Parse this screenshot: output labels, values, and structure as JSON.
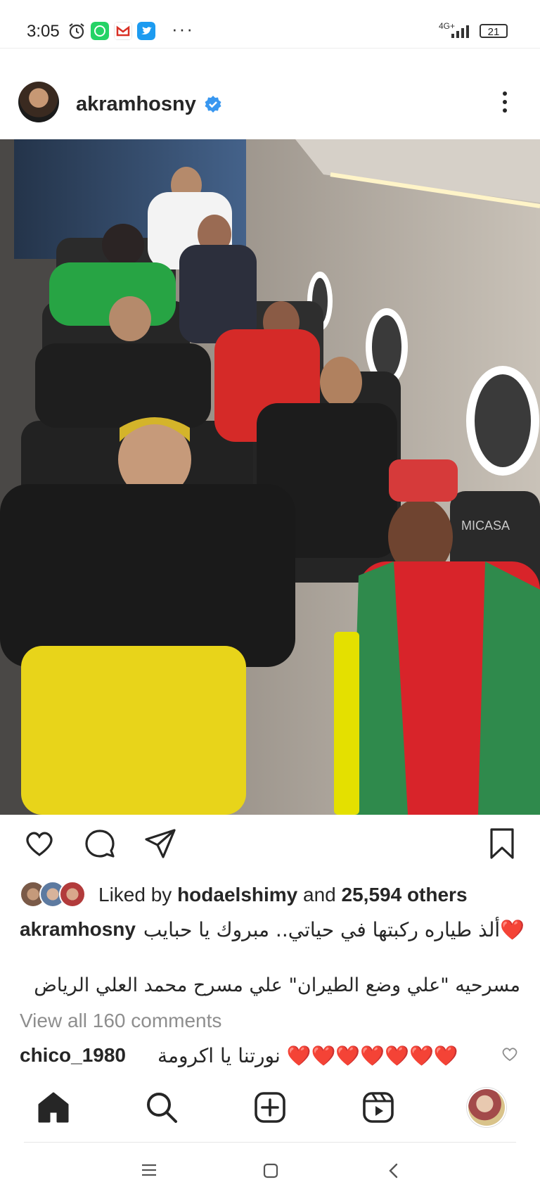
{
  "status_bar": {
    "time": "3:05",
    "network": "4G+",
    "battery": "21",
    "more": "···"
  },
  "post": {
    "username": "akramhosny",
    "likes": {
      "prefix": "Liked by ",
      "user": "hodaelshimy",
      "middle": " and ",
      "others": "25,594 others"
    },
    "caption_user": "akramhosny",
    "caption_line1": "❤️ألذ طياره ركبتها في حياتي.. مبروك يا حبايب",
    "caption_line2": "مسرحيه \"علي وضع الطيران\" علي مسرح محمد العلي الرياض",
    "view_all_comments": "View all 160 comments",
    "comment": {
      "user": "chico_1980",
      "text": "❤️❤️❤️❤️❤️❤️❤️ نورتنا يا اكرومة"
    }
  },
  "photo": {
    "brand_text": "MICASA"
  },
  "colors": {
    "accent_blue": "#3897f0",
    "text": "#262626",
    "muted": "#8e8e8e"
  }
}
